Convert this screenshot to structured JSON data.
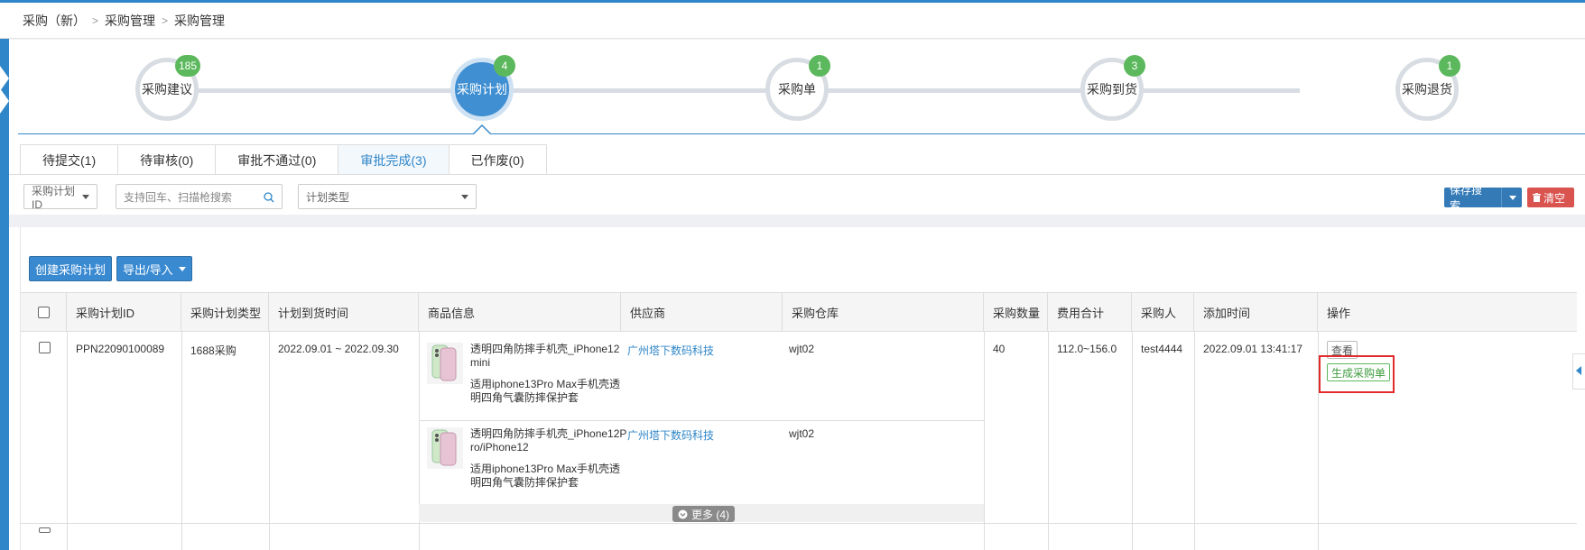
{
  "breadcrumb": [
    "采购（新）",
    "采购管理",
    "采购管理"
  ],
  "steps": [
    {
      "label": "采购建议",
      "count": "185",
      "active": false
    },
    {
      "label": "采购计划",
      "count": "4",
      "active": true
    },
    {
      "label": "采购单",
      "count": "1",
      "active": false
    },
    {
      "label": "采购到货",
      "count": "3",
      "active": false
    },
    {
      "label": "采购退货",
      "count": "1",
      "active": false
    }
  ],
  "tabs": [
    "待提交(1)",
    "待审核(0)",
    "审批不通过(0)",
    "审批完成(3)",
    "已作废(0)"
  ],
  "active_tab": "审批完成(3)",
  "filters": {
    "id_select": "采购计划ID",
    "search_placeholder": "支持回车、扫描枪搜索",
    "type_select": "计划类型",
    "save_search": "保存搜索",
    "clear": "清空"
  },
  "actions": {
    "create": "创建采购计划",
    "export_import": "导出/导入"
  },
  "columns": [
    "采购计划ID",
    "采购计划类型",
    "计划到货时间",
    "商品信息",
    "供应商",
    "采购仓库",
    "采购数量",
    "费用合计",
    "采购人",
    "添加时间",
    "操作"
  ],
  "row": {
    "id": "PPN22090100089",
    "type": "1688采购",
    "arrival": "2022.09.01 ~ 2022.09.30",
    "products": [
      {
        "title_line1": "透明四角防摔手机壳_iPhone12",
        "title_line2": "mini",
        "desc_line1": "适用iphone13Pro Max手机壳透",
        "desc_line2": "明四角气囊防摔保护套",
        "supplier": "广州塔下数码科技",
        "warehouse": "wjt02"
      },
      {
        "title_line1": "透明四角防摔手机壳_iPhone12P",
        "title_line2": "ro/iPhone12",
        "desc_line1": "适用iphone13Pro Max手机壳透",
        "desc_line2": "明四角气囊防摔保护套",
        "supplier": "广州塔下数码科技",
        "warehouse": "wjt02"
      }
    ],
    "quantity": "40",
    "cost": "112.0~156.0",
    "buyer": "test4444",
    "added": "2022.09.01 13:41:17",
    "op_view": "查看",
    "op_generate": "生成采购单",
    "more": "更多 (4)"
  }
}
